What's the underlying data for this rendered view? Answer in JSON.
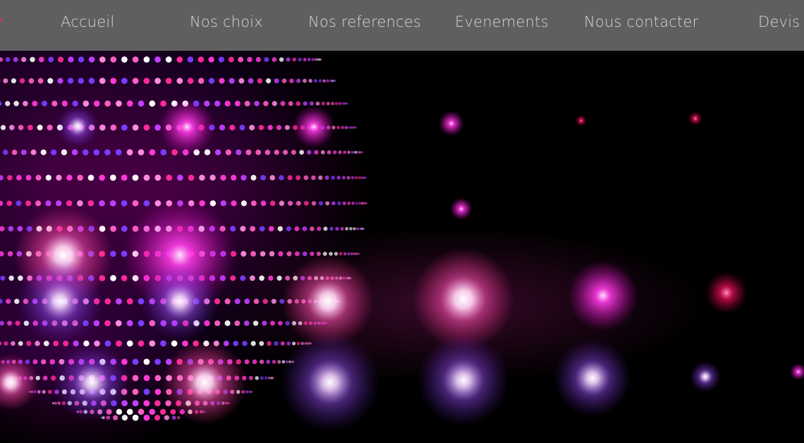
{
  "navigation": {
    "items": [
      {
        "label": "Accueil"
      },
      {
        "label": "Nos choix"
      },
      {
        "label": "Nos references"
      },
      {
        "label": "Evenements"
      },
      {
        "label": "Nous contacter"
      },
      {
        "label": "Devis"
      }
    ]
  },
  "hero": {
    "image": "disco-ball-lights"
  },
  "colors": {
    "navbar_background": "#5f5f5f",
    "nav_text": "#d6d6d6",
    "hero_background": "#000000",
    "accent_magenta": "#ff2bd6",
    "accent_pink": "#ff6ab0",
    "accent_violet": "#8a3cff"
  }
}
